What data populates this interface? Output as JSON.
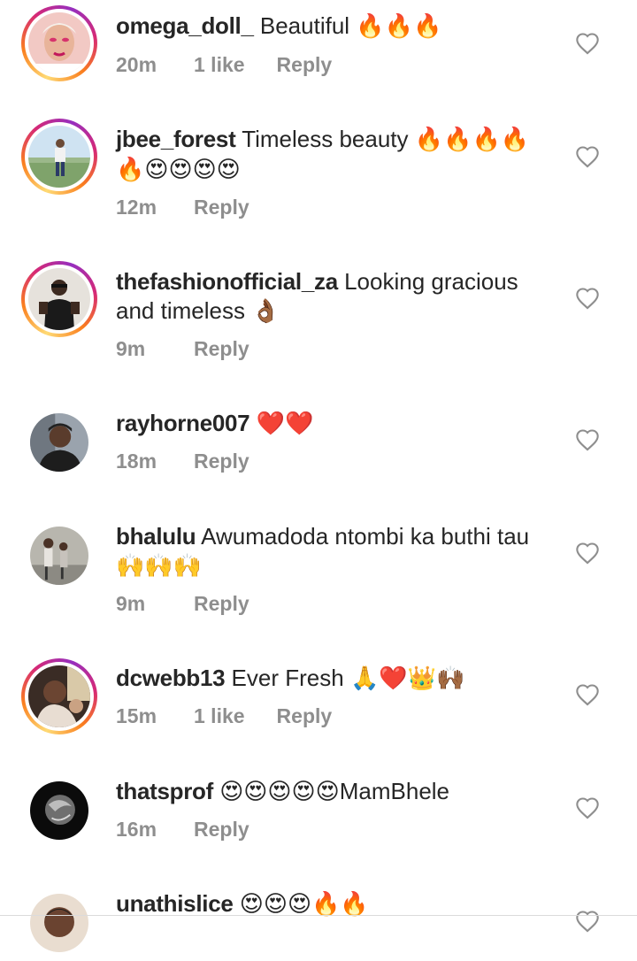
{
  "comments": [
    {
      "username": "omega_doll_",
      "text": "Beautiful",
      "emoji": "🔥🔥🔥",
      "time": "20m",
      "likes": "1 like",
      "reply": "Reply",
      "ring": true
    },
    {
      "username": "jbee_forest",
      "text": "Timeless beauty",
      "emoji": "🔥🔥🔥🔥🔥😍😍😍😍",
      "time": "12m",
      "likes": "",
      "reply": "Reply",
      "ring": true
    },
    {
      "username": "thefashionofficial_za",
      "text": "Looking gracious and timeless",
      "emoji": "👌🏾",
      "time": "9m",
      "likes": "",
      "reply": "Reply",
      "ring": true
    },
    {
      "username": "rayhorne007",
      "text": "",
      "emoji": "❤️❤️",
      "time": "18m",
      "likes": "",
      "reply": "Reply",
      "ring": false
    },
    {
      "username": "bhalulu",
      "text": "Awumadoda ntombi ka buthi tau",
      "emoji": "🙌🙌🙌",
      "time": "9m",
      "likes": "",
      "reply": "Reply",
      "ring": false
    },
    {
      "username": "dcwebb13",
      "text": "Ever Fresh",
      "emoji": "🙏❤️👑🙌🏾",
      "time": "15m",
      "likes": "1 like",
      "reply": "Reply",
      "ring": true
    },
    {
      "username": "thatsprof",
      "text": "MamBhele",
      "emoji": "😍😍😍😍😍",
      "time": "16m",
      "likes": "",
      "reply": "Reply",
      "ring": false
    },
    {
      "username": "unathislice",
      "text": "",
      "emoji": "😍😍😍🔥🔥",
      "time": "",
      "likes": "",
      "reply": "",
      "ring": false
    }
  ],
  "icons": {
    "like": "heart-outline-icon",
    "avatar": "profile-photo"
  },
  "colors": {
    "meta": "#8e8e8e",
    "text": "#262626",
    "ring_start": "#fa7e1e",
    "ring_end": "#d62976"
  }
}
